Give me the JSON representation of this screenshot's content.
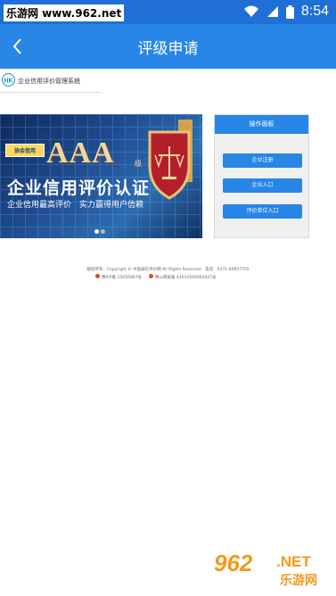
{
  "status_bar": {
    "watermark": "乐游网 www.962.net",
    "time": "8:54"
  },
  "app_bar": {
    "title": "评级申请"
  },
  "site": {
    "brand": "企业信用评价管理系统",
    "logo_text": "HK"
  },
  "banner": {
    "badge": "协会信用",
    "rating": "AAA",
    "rating_suffix": "级",
    "headline": "企业信用评价认证",
    "subline": "企业信用最高评价　实力赢得用户信赖"
  },
  "panel": {
    "title": "操作面板",
    "buttons": [
      "企业注册",
      "企业入口",
      "评价单位入口"
    ]
  },
  "footer": {
    "line1": "版权所有：Copyright © 中国诚信评价网 All Rights Reserved　电话：0371-60957755",
    "icp": "豫ICP备 15035067号",
    "police": "豫公网安备 41010502003027号"
  },
  "watermark_bottom": {
    "num": "962",
    "net": ".NET",
    "cn": "乐游网"
  },
  "colors": {
    "primary": "#2786e6",
    "status": "#1f6fd6",
    "gold": "#f0d7a0"
  }
}
